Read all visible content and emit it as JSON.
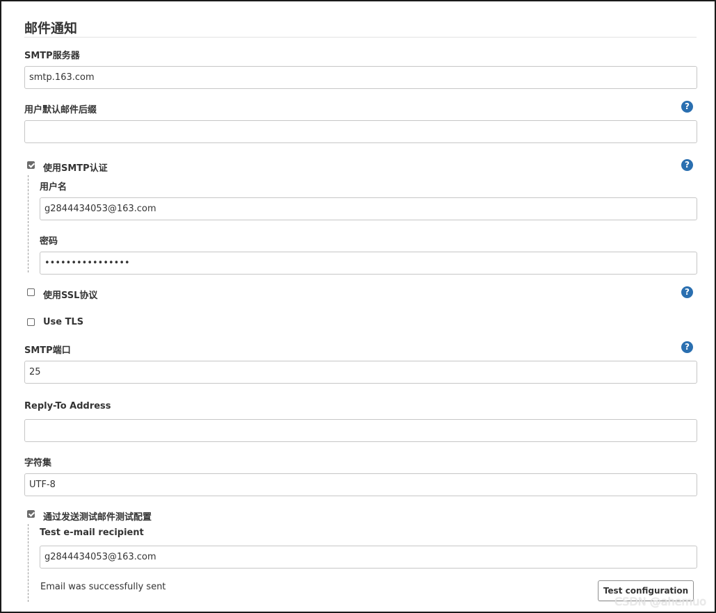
{
  "section": {
    "title": "邮件通知"
  },
  "smtp_server": {
    "label": "SMTP服务器",
    "value": "smtp.163.com"
  },
  "default_suffix": {
    "label": "用户默认邮件后缀",
    "value": ""
  },
  "smtp_auth": {
    "label": "使用SMTP认证",
    "checked": true,
    "username_label": "用户名",
    "username_value": "g2844434053@163.com",
    "password_label": "密码",
    "password_value": "••••••••••••••••"
  },
  "ssl": {
    "label": "使用SSL协议",
    "checked": false
  },
  "tls": {
    "label": "Use TLS",
    "checked": false
  },
  "smtp_port": {
    "label": "SMTP端口",
    "value": "25"
  },
  "reply_to": {
    "label": "Reply-To Address",
    "value": ""
  },
  "charset": {
    "label": "字符集",
    "value": "UTF-8"
  },
  "test_config": {
    "label": "通过发送测试邮件测试配置",
    "checked": true,
    "recipient_label": "Test e-mail recipient",
    "recipient_value": "g2844434053@163.com",
    "status": "Email was successfully sent",
    "button_label": "Test configuration"
  },
  "help_icon_glyph": "?",
  "watermark": "CSDN @ahemuo",
  "colors": {
    "help_icon": "#2a6fb0",
    "checkbox_checked": "#6b6b6b"
  }
}
